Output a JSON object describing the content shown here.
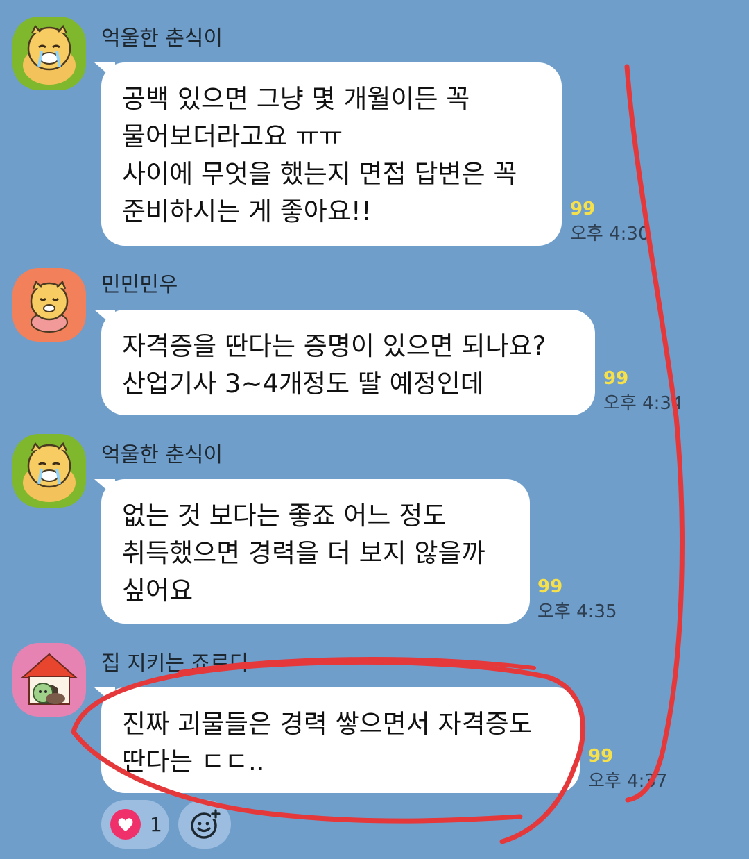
{
  "messages": [
    {
      "sender": "억울한 춘식이",
      "avatar_icon": "chunsik-crying-icon",
      "lines": [
        "공백 있으면 그냥 몇 개월이든 꼭",
        "물어보더라고요 ㅠㅠ",
        "사이에 무엇을 했는지 면접 답변은 꼭",
        "준비하시는 게 좋아요!!"
      ],
      "unread": "99",
      "time": "오후 4:30"
    },
    {
      "sender": "민민민우",
      "avatar_icon": "chunsik-worried-icon",
      "lines": [
        "자격증을 딴다는 증명이 있으면 되나요?",
        "산업기사 3~4개정도 딸 예정인데"
      ],
      "unread": "99",
      "time": "오후 4:34"
    },
    {
      "sender": "억울한 춘식이",
      "avatar_icon": "chunsik-crying-icon",
      "lines": [
        "없는 것 보다는 좋죠 어느 정도",
        "취득했으면 경력을 더 보지 않을까",
        "싶어요"
      ],
      "unread": "99",
      "time": "오후 4:35"
    },
    {
      "sender": "집 지키는 죠르디",
      "avatar_icon": "jordy-doghouse-icon",
      "lines": [
        "진짜 괴물들은 경력 쌓으면서 자격증도",
        "딴다는 ㄷㄷ.."
      ],
      "unread": "99",
      "time": "오후 4:37"
    }
  ],
  "reactions": {
    "heart_icon": "heart-icon",
    "heart_count": "1",
    "add_reaction_icon": "add-emoji-icon"
  },
  "colors": {
    "background": "#6f9ecb",
    "bubble": "#ffffff",
    "unread": "#f6e14a",
    "annotation": "#e5383b",
    "heart": "#f0306a"
  }
}
